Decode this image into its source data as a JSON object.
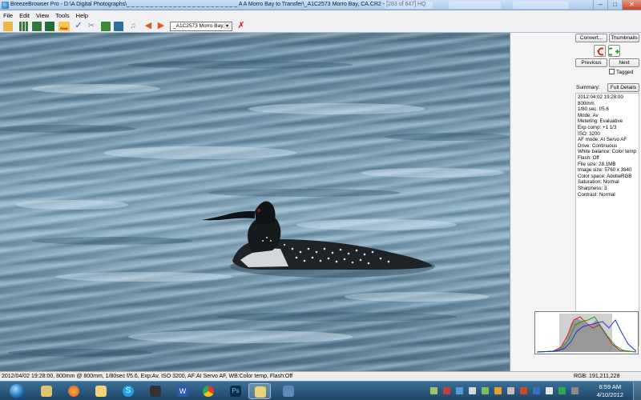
{
  "window": {
    "title": "BreezeBrowser Pro - D:\\A Digital Photographs\\_ _ _ _ _ _ _ _ _ _ _ _ _ _ _ _ _ _ _ _ _ _ _ _ A A Morro Bay to Transfer\\_A1C2573  Morro Bay, CA.CR2 - [283 of 647] HQ",
    "minimize": "–",
    "maximize": "□",
    "close": "✕"
  },
  "menu": [
    "File",
    "Edit",
    "View",
    "Tools",
    "Help"
  ],
  "toolbar": {
    "file_select": "_A1C2573  Morro Bay,",
    "raw_label": "RAW"
  },
  "panel": {
    "convert": "Convert...",
    "thumbnails": "Thumbnails",
    "previous": "Previous",
    "next": "Next",
    "tagged": "Tagged",
    "summary_label": "Summary:",
    "full_details": "Full Details",
    "summary_lines": [
      "2012:04:02 19:28:00",
      "800mm",
      "1/80 sec. f/5.6",
      "Mode: Av",
      "Metering: Evaluative",
      "Exp comp: +1 1/3",
      "ISO: 3200",
      "AF mode: AI Servo AF",
      "Drive: Continuous",
      "White balance: Color temp",
      "Flash: Off",
      "File size: 28.1MB",
      "Image size: 5760 x 3840",
      "Color space: AdobeRGB",
      "Saturation: Normal",
      "Sharpness: 3",
      "Contrast: Normal"
    ]
  },
  "status": {
    "info": "2012/04/02 19:28:00, 800mm @ 800mm, 1/80sec f/5.6, Exp:Av, ISO 3200, AF:AI Servo AF, WB:Color temp, Flash:Off",
    "rgb": "RGB: 191,211,228"
  },
  "taskbar": {
    "time": "8:59 AM",
    "date": "4/10/2012"
  }
}
